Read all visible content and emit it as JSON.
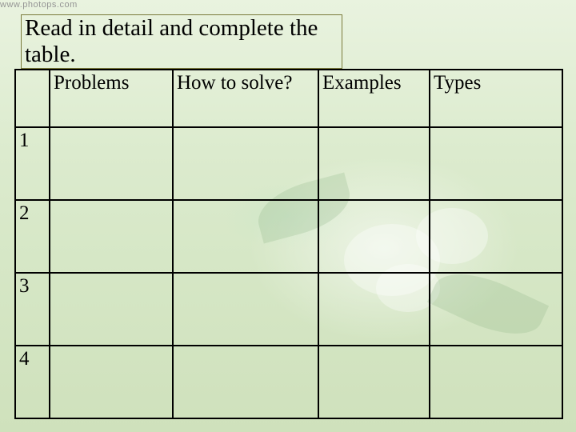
{
  "watermark": "www.photops.com",
  "title": "Read in detail and complete the table.",
  "table": {
    "headers": {
      "num": "",
      "problems": "Problems",
      "how": "How to solve?",
      "examples": "Examples",
      "types": "Types"
    },
    "rows": [
      {
        "num": "1",
        "problems": "",
        "how": "",
        "examples": "",
        "types": ""
      },
      {
        "num": "2",
        "problems": "",
        "how": "",
        "examples": "",
        "types": ""
      },
      {
        "num": "3",
        "problems": "",
        "how": "",
        "examples": "",
        "types": ""
      },
      {
        "num": "4",
        "problems": "",
        "how": "",
        "examples": "",
        "types": ""
      }
    ]
  }
}
